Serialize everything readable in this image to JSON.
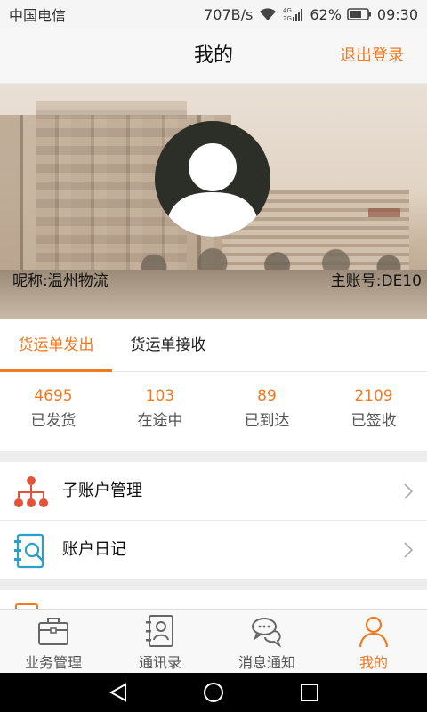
{
  "status_bar": {
    "carrier": "中国电信",
    "speed": "707B/s",
    "battery": "62%",
    "time": "09:30",
    "net_top": "4G",
    "net_bottom": "2G"
  },
  "header": {
    "title": "我的",
    "logout_label": "退出登录"
  },
  "profile": {
    "nickname": "昵称:温州物流",
    "account_no": "主账号:DE10"
  },
  "tabs": [
    {
      "label": "货运单发出",
      "active": true
    },
    {
      "label": "货运单接收",
      "active": false
    }
  ],
  "stats": [
    {
      "value": "4695",
      "label": "已发货"
    },
    {
      "value": "103",
      "label": "在途中"
    },
    {
      "value": "89",
      "label": "已到达"
    },
    {
      "value": "2109",
      "label": "已签收"
    }
  ],
  "menu": [
    {
      "label": "子账户管理",
      "icon": "org-chart-icon"
    },
    {
      "label": "账户日记",
      "icon": "notebook-search-icon"
    }
  ],
  "bottom_nav": [
    {
      "label": "业务管理",
      "icon": "briefcase-icon",
      "active": false
    },
    {
      "label": "通讯录",
      "icon": "contacts-icon",
      "active": false
    },
    {
      "label": "消息通知",
      "icon": "chat-bubbles-icon",
      "active": false
    },
    {
      "label": "我的",
      "icon": "user-icon",
      "active": true
    }
  ],
  "colors": {
    "accent": "#f07a22",
    "icon_blue": "#2aa0c8",
    "icon_red": "#e2533a"
  }
}
